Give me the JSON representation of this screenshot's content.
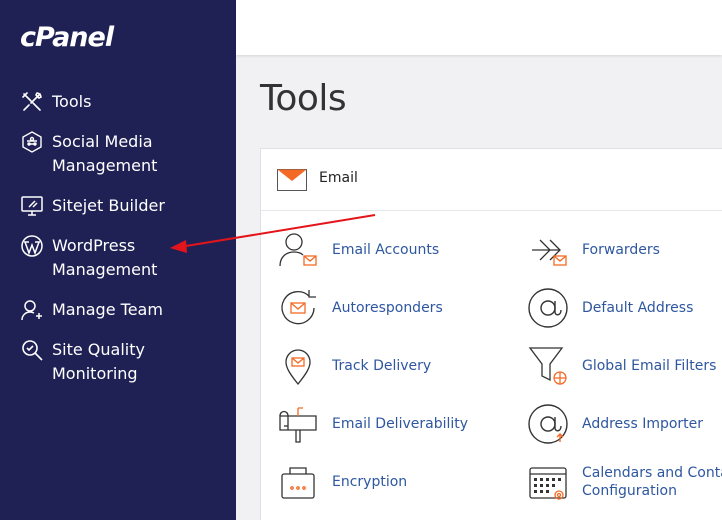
{
  "brand": {
    "logo_text": "cPanel"
  },
  "sidebar": {
    "items": [
      {
        "label": "Tools",
        "icon": "tools-icon"
      },
      {
        "label": "Social Media Management",
        "icon": "social-media-icon"
      },
      {
        "label": "Sitejet Builder",
        "icon": "sitejet-icon"
      },
      {
        "label": "WordPress Management",
        "icon": "wordpress-icon"
      },
      {
        "label": "Manage Team",
        "icon": "manage-team-icon"
      },
      {
        "label": "Site Quality Monitoring",
        "icon": "site-quality-icon"
      }
    ]
  },
  "main": {
    "title": "Tools",
    "email_panel": {
      "title": "Email",
      "tools": [
        {
          "label": "Email Accounts",
          "icon": "email-accounts-icon"
        },
        {
          "label": "Forwarders",
          "icon": "forwarders-icon"
        },
        {
          "label": "Autoresponders",
          "icon": "autoresponders-icon"
        },
        {
          "label": "Default Address",
          "icon": "default-address-icon"
        },
        {
          "label": "Track Delivery",
          "icon": "track-delivery-icon"
        },
        {
          "label": "Global Email Filters",
          "icon": "global-email-filters-icon"
        },
        {
          "label": "Email Deliverability",
          "icon": "email-deliverability-icon"
        },
        {
          "label": "Address Importer",
          "icon": "address-importer-icon"
        },
        {
          "label": "Encryption",
          "icon": "encryption-icon"
        },
        {
          "label": "Calendars and Contacts Configuration",
          "line1": "Calendars and Contacts",
          "line2": "Configuration",
          "icon": "calendars-contacts-icon"
        }
      ]
    }
  },
  "colors": {
    "sidebar_bg": "#1f2155",
    "accent_orange": "#f46a24",
    "link_blue": "#2e57a0",
    "annotation_arrow": "#e3141b"
  }
}
